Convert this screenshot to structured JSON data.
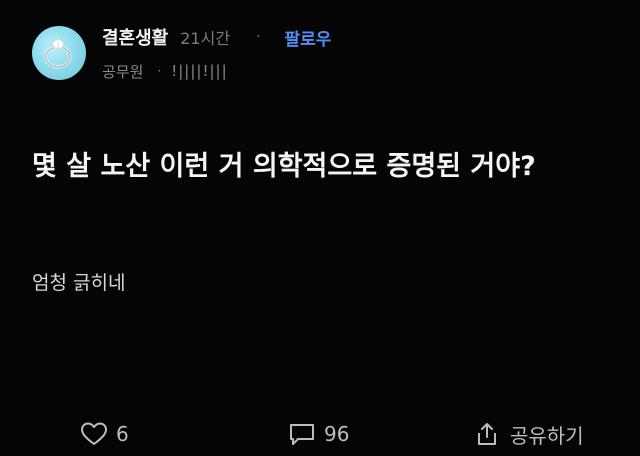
{
  "post": {
    "author": "결혼생활",
    "time": "21시간",
    "separator": "·",
    "follow_label": "팔로우",
    "company": "공무원",
    "nickname": "!||||!|||",
    "title": "몇 살 노산 이런 거 의학적으로 증명된 거야?",
    "body": "엄청 긁히네"
  },
  "footer": {
    "like_count": "6",
    "comment_count": "96",
    "share_label": "공유하기"
  },
  "colors": {
    "background": "#050505",
    "follow": "#4f8ff7",
    "muted": "#7d7d7d",
    "avatar": "#8fdcec"
  }
}
